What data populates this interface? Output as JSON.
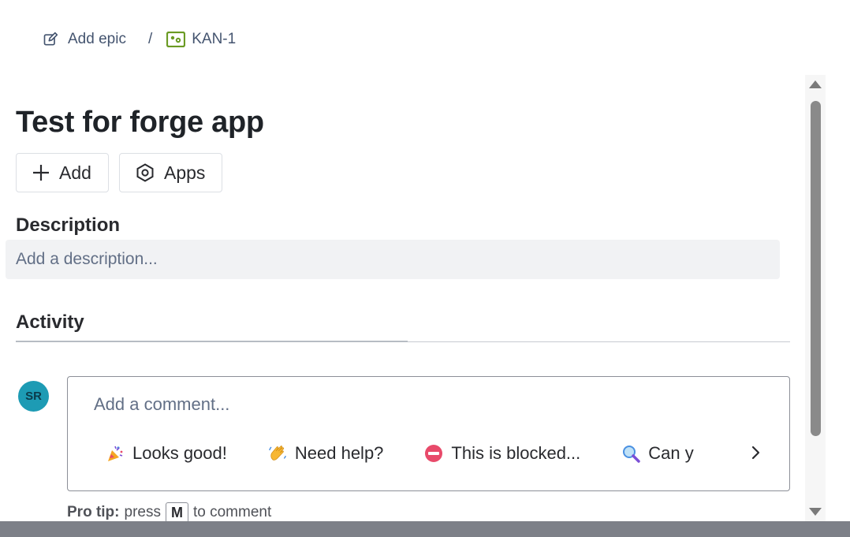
{
  "breadcrumb": {
    "epic_label": "Add epic",
    "separator": "/",
    "issue_key": "KAN-1",
    "epic_icon": "edit-icon",
    "issue_icon": "story-icon"
  },
  "issue": {
    "title": "Test for forge app"
  },
  "toolbar": {
    "add_label": "Add",
    "apps_label": "Apps"
  },
  "description": {
    "heading": "Description",
    "placeholder": "Add a description..."
  },
  "activity": {
    "heading": "Activity",
    "avatar_initials": "SR",
    "comment_placeholder": "Add a comment...",
    "quick_replies": [
      {
        "emoji": "party-popper-icon",
        "label": "Looks good!"
      },
      {
        "emoji": "waving-hand-icon",
        "label": "Need help?"
      },
      {
        "emoji": "no-entry-icon",
        "label": "This is blocked..."
      },
      {
        "emoji": "magnifier-icon",
        "label": "Can y"
      }
    ],
    "pro_tip_label": "Pro tip:",
    "pro_tip_pre": "press",
    "pro_tip_key": "M",
    "pro_tip_post": "to comment"
  },
  "colors": {
    "avatar_bg": "#1d9bb4",
    "story_icon": "#6a9a23",
    "no_entry": "#e84a6a"
  }
}
